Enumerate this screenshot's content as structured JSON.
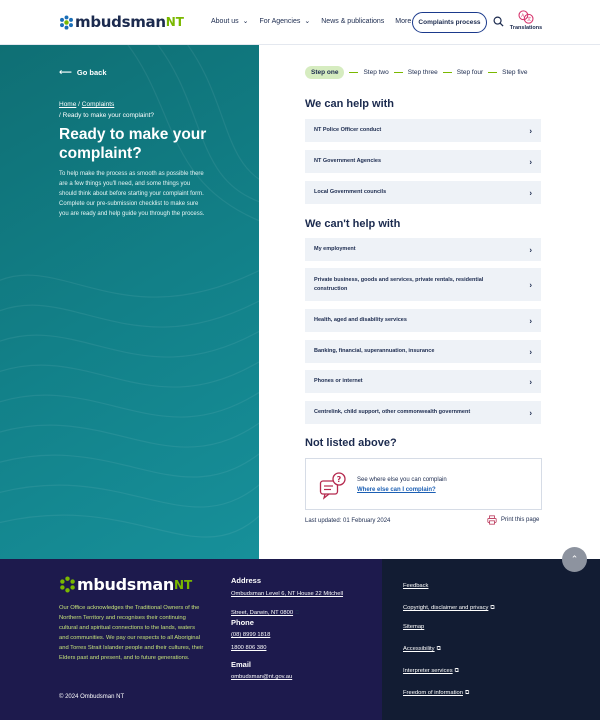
{
  "header": {
    "logo_main": "mbudsman",
    "logo_suffix": "NT",
    "nav": [
      {
        "label": "About us",
        "has_dropdown": true
      },
      {
        "label": "For Agencies",
        "has_dropdown": true
      },
      {
        "label": "News & publications",
        "has_dropdown": false
      },
      {
        "label": "More",
        "has_dropdown": true
      }
    ],
    "complaints_button": "Complaints process",
    "translations_label": "Translations",
    "search_icon": "search-icon"
  },
  "hero": {
    "go_back": "Go back",
    "breadcrumb_home": "Home",
    "breadcrumb_complaints": "Complaints",
    "breadcrumb_current": "Ready to make your complaint?",
    "title": "Ready to make your complaint?",
    "text": "To help make the process as smooth as possible there are a few things you'll need, and some things you should think about before starting your complaint form. Complete our pre-submission checklist to make sure you are ready and help guide you through the process."
  },
  "steps": [
    "Step one",
    "Step two",
    "Step three",
    "Step four",
    "Step five"
  ],
  "can_help": {
    "title": "We can help with",
    "items": [
      "NT Police Officer conduct",
      "NT Government Agencies",
      "Local Government councils"
    ]
  },
  "cant_help": {
    "title": "We can't help with",
    "items": [
      "My employment",
      "Private business, goods and services, private rentals, residential construction",
      "Health, aged and disability services",
      "Banking, financial, superannuation, insurance",
      "Phones or internet",
      "Centrelink, child support, other commonwealth government"
    ]
  },
  "not_listed": {
    "title": "Not listed above?",
    "text": "See where else you can complain",
    "link": "Where else can I complain?"
  },
  "last_updated": "Last updated: 01 February 2024",
  "print_label": "Print this page",
  "footer": {
    "logo_main": "mbudsman",
    "logo_suffix": "NT",
    "acknowledgement": "Our Office acknowledges the Traditional Owners of the Northern Territory and recognises their continuing cultural and spiritual connections to the lands, waters and communities. We pay our respects to all Aboriginal and Torres Strait Islander people and their cultures, their Elders past and present, and to future generations.",
    "copyright": "© 2024 Ombudsman NT",
    "address_heading": "Address",
    "address_line1": "Ombudsman Level 6, NT House 22 Mitchell",
    "address_line2": "Street, Darwin, NT 0800",
    "phone_heading": "Phone",
    "phone1": "(08) 8999 1818",
    "phone2": "1800 806 380",
    "email_heading": "Email",
    "email": "ombudsman@nt.gov.au",
    "links": [
      {
        "label": "Feedback",
        "external": false
      },
      {
        "label": "Copyright, disclaimer and privacy",
        "external": true
      },
      {
        "label": "Sitemap",
        "external": false
      },
      {
        "label": "Accessibility",
        "external": true
      },
      {
        "label": "Interpreter services",
        "external": true
      },
      {
        "label": "Freedom of information",
        "external": true
      }
    ]
  },
  "colors": {
    "navy": "#1b2a4e",
    "teal": "#128088",
    "green": "#7ab800",
    "row_bg": "#eef2f7",
    "footer_bg": "#1d1a4d",
    "footer_right_bg": "#121c33"
  }
}
